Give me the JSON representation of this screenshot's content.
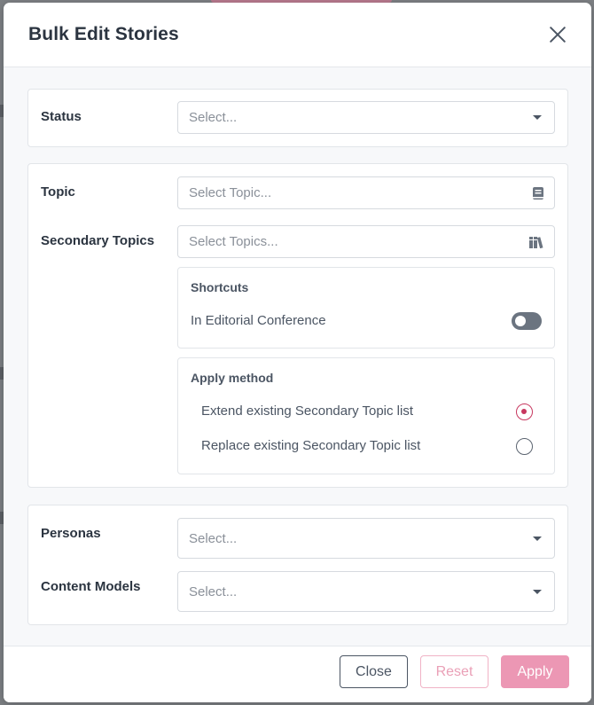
{
  "modal": {
    "title": "Bulk Edit Stories",
    "close_icon": "close-icon"
  },
  "status": {
    "label": "Status",
    "placeholder": "Select..."
  },
  "topic": {
    "label": "Topic",
    "placeholder": "Select Topic...",
    "icon": "book-icon"
  },
  "secondary_topics": {
    "label": "Secondary Topics",
    "placeholder": "Select Topics...",
    "icon": "books-icon",
    "shortcuts": {
      "title": "Shortcuts",
      "toggle_label": "In Editorial Conference",
      "toggle_on": false
    },
    "apply_method": {
      "title": "Apply method",
      "options": [
        {
          "label": "Extend existing Secondary Topic list",
          "selected": true
        },
        {
          "label": "Replace existing Secondary Topic list",
          "selected": false
        }
      ]
    }
  },
  "personas": {
    "label": "Personas",
    "placeholder": "Select..."
  },
  "content_models": {
    "label": "Content Models",
    "placeholder": "Select..."
  },
  "footer": {
    "close_label": "Close",
    "reset_label": "Reset",
    "apply_label": "Apply"
  },
  "colors": {
    "accent": "#c7375f",
    "apply_button": "#ec97b4",
    "reset_border": "#f0b3c6",
    "toggle_off": "#6b7480"
  }
}
